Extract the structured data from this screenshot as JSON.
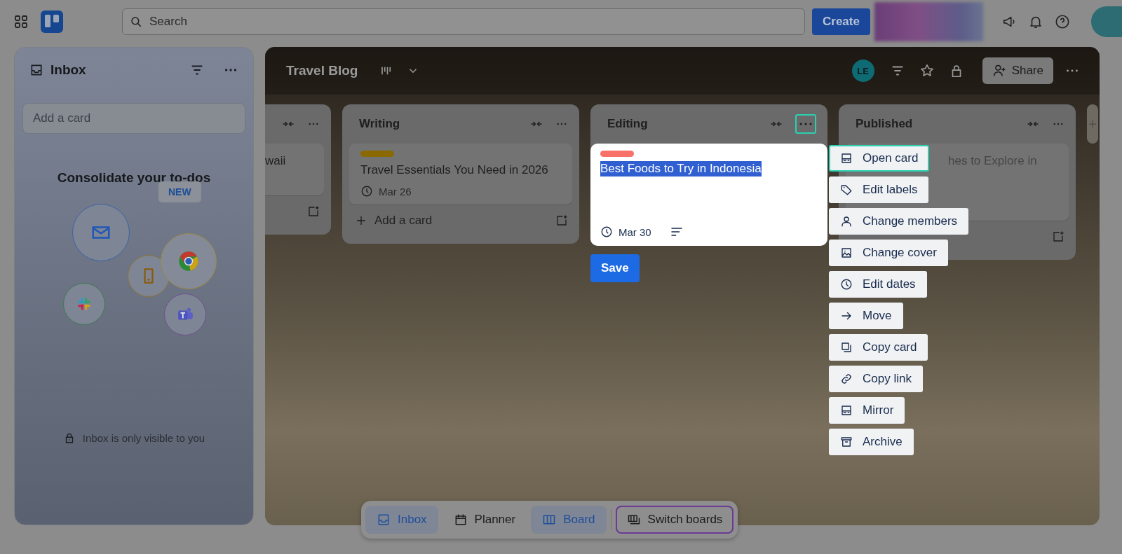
{
  "top_bar": {
    "search_placeholder": "Search",
    "create_button": "Create"
  },
  "inbox": {
    "title": "Inbox",
    "add_card_placeholder": "Add a card",
    "promo_title": "Consolidate your to-dos",
    "new_badge": "NEW",
    "privacy_note": "Inbox is only visible to you"
  },
  "board": {
    "title": "Travel Blog",
    "member_initials": "LE",
    "share_button": "Share",
    "lists": [
      {
        "kind": "partial",
        "cards": [
          {
            "title": "waii"
          }
        ]
      },
      {
        "kind": "full",
        "title": "Writing",
        "cards": [
          {
            "color": "#8a6a00",
            "title": "Travel Essentials You Need in 2026",
            "due": "Mar 26"
          }
        ],
        "add_card": "Add a card"
      },
      {
        "kind": "editing",
        "title": "Editing",
        "menu_open": true,
        "cards": [
          {
            "color": "#f87168",
            "title": "Best Foods to Try in Indonesia",
            "title_selected": true,
            "due": "Mar 30",
            "has_description": true
          }
        ],
        "save_button": "Save"
      },
      {
        "kind": "covered",
        "title": "Published",
        "cards": [
          {
            "title": "hes to Explore in"
          }
        ]
      }
    ]
  },
  "card_menu": [
    {
      "kind": "card",
      "label": "Open card",
      "focused": true
    },
    {
      "kind": "tag",
      "label": "Edit labels",
      "focused": false
    },
    {
      "kind": "person",
      "label": "Change members",
      "focused": false
    },
    {
      "kind": "image",
      "label": "Change cover",
      "focused": false
    },
    {
      "kind": "clock",
      "label": "Edit dates",
      "focused": false
    },
    {
      "kind": "arrow",
      "label": "Move",
      "focused": false
    },
    {
      "kind": "copy",
      "label": "Copy card",
      "focused": false
    },
    {
      "kind": "link",
      "label": "Copy link",
      "focused": false
    },
    {
      "kind": "mirror",
      "label": "Mirror",
      "focused": false
    },
    {
      "kind": "archive",
      "label": "Archive",
      "focused": false
    }
  ],
  "bottom_nav": [
    {
      "kind": "inbox",
      "label": "Inbox",
      "selected": true,
      "focused": false
    },
    {
      "kind": "calendar",
      "label": "Planner",
      "selected": false,
      "focused": false
    },
    {
      "kind": "board",
      "label": "Board",
      "selected": true,
      "focused": false
    },
    {
      "kind": "switch",
      "label": "Switch boards",
      "selected": false,
      "focused": true
    }
  ]
}
